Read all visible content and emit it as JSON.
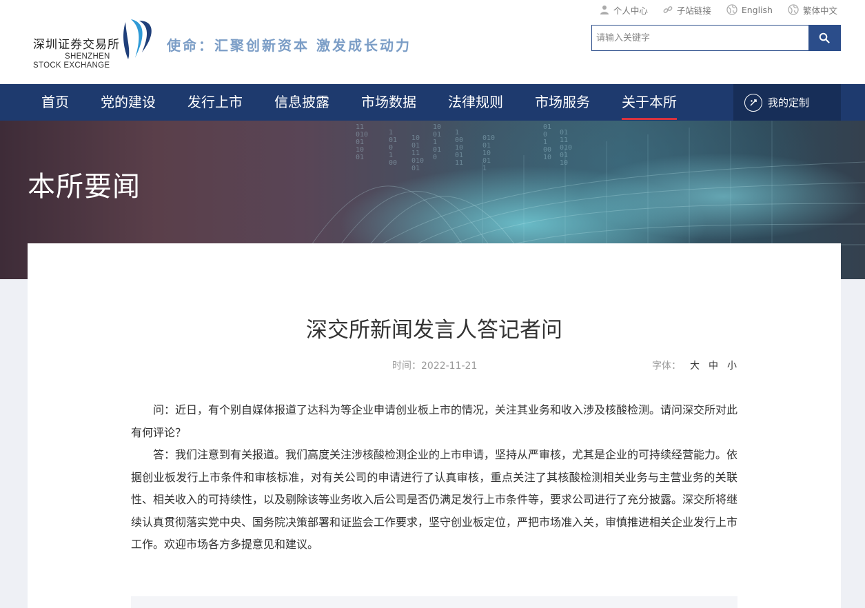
{
  "header": {
    "logo_cn": "深圳证券交易所",
    "logo_en_line1": "SHENZHEN",
    "logo_en_line2": "STOCK EXCHANGE",
    "slogan": "使命：汇聚创新资本 激发成长动力",
    "top_links": [
      {
        "label": "个人中心",
        "icon": "user-icon"
      },
      {
        "label": "子站链接",
        "icon": "link-icon"
      },
      {
        "label": "English",
        "icon": "globe-icon"
      },
      {
        "label": "繁体中文",
        "icon": "globe-icon"
      }
    ],
    "search": {
      "placeholder": "请输入关键字",
      "value": ""
    }
  },
  "nav": {
    "items": [
      {
        "label": "首页"
      },
      {
        "label": "党的建设"
      },
      {
        "label": "发行上市"
      },
      {
        "label": "信息披露"
      },
      {
        "label": "市场数据"
      },
      {
        "label": "法律规则"
      },
      {
        "label": "市场服务"
      },
      {
        "label": "关于本所",
        "active": true
      }
    ],
    "custom_label": "我的定制"
  },
  "banner": {
    "title": "本所要闻",
    "digits": [
      "11",
      "010",
      "01",
      "10",
      "01",
      "1",
      "01",
      "0",
      "1",
      "00",
      "10",
      "01"
    ]
  },
  "article": {
    "title": "深交所新闻发言人答记者问",
    "time_label": "时间：",
    "time": "2022-11-21",
    "font_label": "字体：",
    "font_sizes": [
      "大",
      "中",
      "小"
    ],
    "paragraphs": [
      "问：近日，有个别自媒体报道了达科为等企业申请创业板上市的情况，关注其业务和收入涉及核酸检测。请问深交所对此有何评论？",
      "答：我们注意到有关报道。我们高度关注涉核酸检测企业的上市申请，坚持从严审核，尤其是企业的可持续经营能力。依据创业板发行上市条件和审核标准，对有关公司的申请进行了认真审核，重点关注了其核酸检测相关业务与主营业务的关联性、相关收入的可持续性，以及剔除该等业务收入后公司是否仍满足发行上市条件等，要求公司进行了充分披露。深交所将继续认真贯彻落实党中央、国务院决策部署和证监会工作要求，坚守创业板定位，严把市场准入关，审慎推进相关企业发行上市工作。欢迎市场各方多提意见和建议。"
    ]
  },
  "colors": {
    "nav_bg": "#1e3a6e",
    "nav_active_underline": "#d9333f",
    "slogan": "#7b9dc6",
    "search_button": "#2b4d8a"
  }
}
